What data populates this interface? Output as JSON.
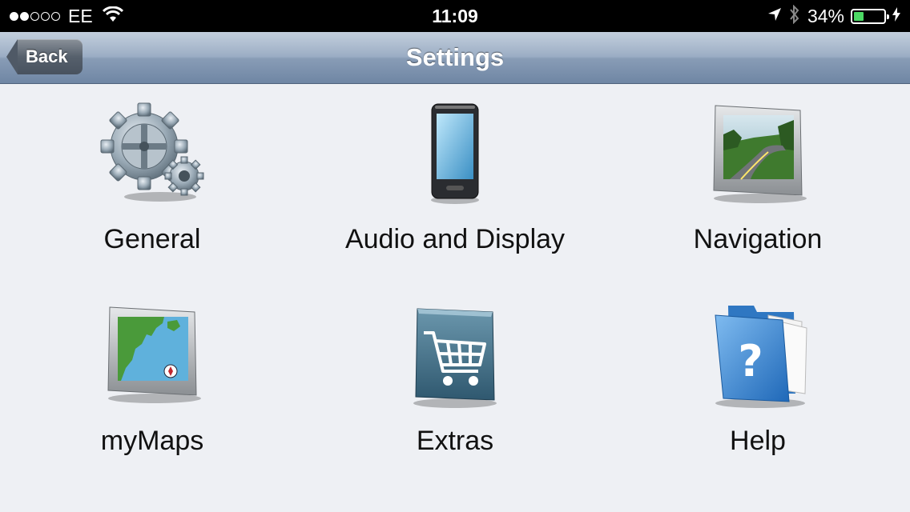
{
  "status_bar": {
    "carrier": "EE",
    "time": "11:09",
    "battery_percent": "34%",
    "battery_level": 0.34,
    "signal_bars": 2,
    "icons": [
      "wifi-icon",
      "location-arrow-icon",
      "bluetooth-icon",
      "charging-bolt-icon"
    ]
  },
  "nav": {
    "back_label": "Back",
    "title": "Settings"
  },
  "menu": {
    "items": [
      {
        "label": "General",
        "icon": "gears-icon"
      },
      {
        "label": "Audio and Display",
        "icon": "phone-icon"
      },
      {
        "label": "Navigation",
        "icon": "navigation-screen-icon"
      },
      {
        "label": "myMaps",
        "icon": "map-screen-icon"
      },
      {
        "label": "Extras",
        "icon": "shopping-cart-icon"
      },
      {
        "label": "Help",
        "icon": "help-folder-icon"
      }
    ]
  }
}
